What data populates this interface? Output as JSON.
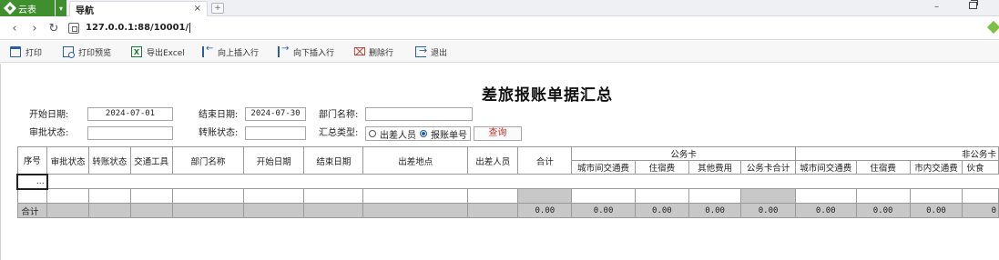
{
  "browser": {
    "app_tab_label": "云表",
    "page_tab_title": "导航",
    "close_glyph": "×",
    "url": "127.0.0.1:88/10001/"
  },
  "toolbar": {
    "print": "打印",
    "print_preview": "打印预览",
    "export_excel": "导出Excel",
    "insert_above": "向上插入行",
    "insert_below": "向下插入行",
    "delete_row": "删除行",
    "exit": "退出",
    "excel_icon_text": "X"
  },
  "form": {
    "title": "差旅报账单据汇总",
    "start_date_label": "开始日期:",
    "start_date_value": "2024-07-01",
    "end_date_label": "结束日期:",
    "end_date_value": "2024-07-30",
    "dept_label": "部门名称:",
    "dept_value": "",
    "approval_label": "审批状态:",
    "approval_value": "",
    "transfer_label": "转账状态:",
    "transfer_value": "",
    "summary_type_label": "汇总类型:",
    "summary_options": [
      "出差人员",
      "报账单号"
    ],
    "summary_selected": "报账单号",
    "query_button": "查询"
  },
  "grid": {
    "headers": {
      "seq": "序号",
      "approval": "审批状态",
      "transfer": "转账状态",
      "transport": "交通工具",
      "dept": "部门名称",
      "start": "开始日期",
      "end": "结束日期",
      "place": "出差地点",
      "person": "出差人员",
      "total": "合计",
      "group_card": "公务卡",
      "group_noncard": "非公务卡"
    },
    "card_subs": [
      "城市间交通费",
      "住宿费",
      "其他费用",
      "公务卡合计"
    ],
    "noncard_subs": [
      "城市间交通费",
      "住宿费",
      "市内交通费",
      "伙食"
    ],
    "edit_cell_glyph": "…",
    "total_row_label": "合计",
    "total_values": [
      "0.00",
      "0.00",
      "0.00",
      "0.00",
      "0.00",
      "0.00",
      "0.00",
      "0.00",
      "0"
    ]
  }
}
